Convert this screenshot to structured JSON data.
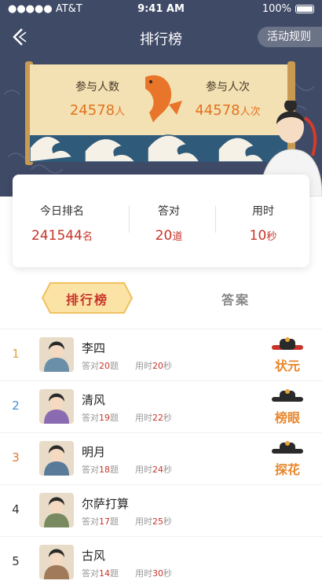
{
  "status_bar": {
    "carrier": "●●●●● AT&T",
    "time": "9:41 AM",
    "battery": "100%"
  },
  "nav": {
    "title": "排行榜",
    "rules_label": "活动规则"
  },
  "banner": {
    "participants_label": "参与人数",
    "participants_value": "24578",
    "participants_unit": "人",
    "attempts_label": "参与人次",
    "attempts_value": "44578",
    "attempts_unit": "人次"
  },
  "summary": {
    "rank_label": "今日排名",
    "rank_value": "241544",
    "rank_unit": "名",
    "correct_label": "答对",
    "correct_value": "20",
    "correct_unit": "道",
    "time_label": "用时",
    "time_value": "10",
    "time_unit": "秒"
  },
  "tabs": {
    "leaderboard": "排行榜",
    "answers": "答案"
  },
  "labels": {
    "correct_prefix": "答对",
    "correct_suffix": "题",
    "time_prefix": "用时",
    "time_suffix": "秒"
  },
  "rows": [
    {
      "rank": "1",
      "name": "李四",
      "correct": "20",
      "time": "20",
      "badge": "状元",
      "rank_color": "#e8a33a"
    },
    {
      "rank": "2",
      "name": "清风",
      "correct": "19",
      "time": "22",
      "badge": "榜眼",
      "rank_color": "#3f8fd8"
    },
    {
      "rank": "3",
      "name": "明月",
      "correct": "18",
      "time": "24",
      "badge": "探花",
      "rank_color": "#e07a30"
    },
    {
      "rank": "4",
      "name": "尔萨打算",
      "correct": "17",
      "time": "25",
      "rank_color": "#333333"
    },
    {
      "rank": "5",
      "name": "古风",
      "correct": "14",
      "time": "30",
      "rank_color": "#333333"
    }
  ],
  "colors": {
    "hero_bg": "#3f4a66",
    "accent_red": "#c8342a",
    "accent_orange": "#e2731f",
    "scroll_paper": "#f3e1b3"
  }
}
